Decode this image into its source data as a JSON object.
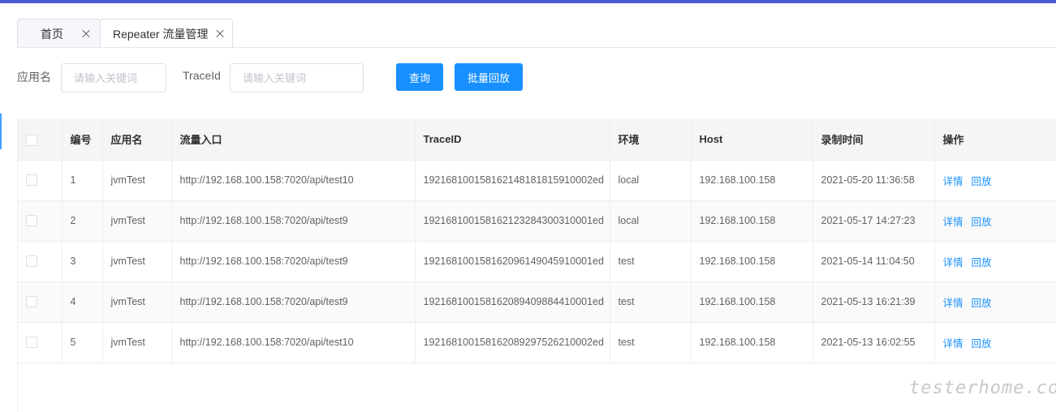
{
  "tabs": [
    {
      "label": "首页"
    },
    {
      "label": "Repeater 流量管理"
    }
  ],
  "search": {
    "app_label": "应用名",
    "app_placeholder": "请输入关键词",
    "trace_label": "TraceId",
    "trace_placeholder": "请输入关键词",
    "query_button": "查询",
    "batch_replay_button": "批量回放"
  },
  "table": {
    "headers": [
      "编号",
      "应用名",
      "流量入口",
      "TraceID",
      "环境",
      "Host",
      "录制时间",
      "操作"
    ],
    "rows": [
      {
        "id": "1",
        "app": "jvmTest",
        "entry": "http://192.168.100.158:7020/api/test10",
        "trace_id": "192168100158162148181815910002ed",
        "env": "local",
        "host": "192.168.100.158",
        "time": "2021-05-20 11:36:58",
        "detail": "详情",
        "replay": "回放"
      },
      {
        "id": "2",
        "app": "jvmTest",
        "entry": "http://192.168.100.158:7020/api/test9",
        "trace_id": "192168100158162123284300310001ed",
        "env": "local",
        "host": "192.168.100.158",
        "time": "2021-05-17 14:27:23",
        "detail": "详情",
        "replay": "回放"
      },
      {
        "id": "3",
        "app": "jvmTest",
        "entry": "http://192.168.100.158:7020/api/test9",
        "trace_id": "192168100158162096149045910001ed",
        "env": "test",
        "host": "192.168.100.158",
        "time": "2021-05-14 11:04:50",
        "detail": "详情",
        "replay": "回放"
      },
      {
        "id": "4",
        "app": "jvmTest",
        "entry": "http://192.168.100.158:7020/api/test9",
        "trace_id": "192168100158162089409884410001ed",
        "env": "test",
        "host": "192.168.100.158",
        "time": "2021-05-13 16:21:39",
        "detail": "详情",
        "replay": "回放"
      },
      {
        "id": "5",
        "app": "jvmTest",
        "entry": "http://192.168.100.158:7020/api/test10",
        "trace_id": "192168100158162089297526210002ed",
        "env": "test",
        "host": "192.168.100.158",
        "time": "2021-05-13 16:02:55",
        "detail": "详情",
        "replay": "回放"
      }
    ]
  },
  "watermark": "testerhome.com",
  "colors": {
    "primary": "#1890ff",
    "top_bar": "#4a5bd8"
  }
}
